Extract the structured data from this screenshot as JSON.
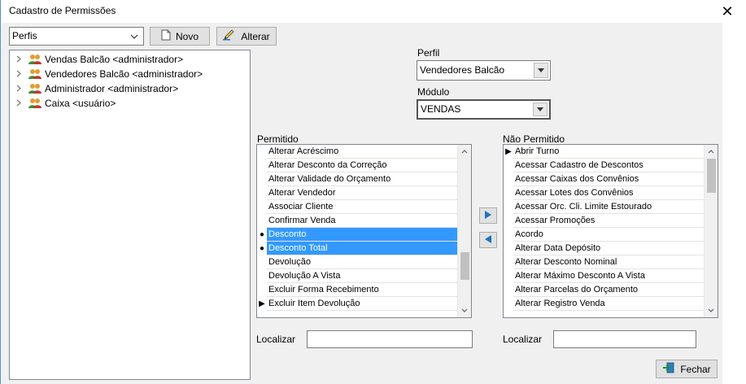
{
  "window": {
    "title": "Cadastro de Permissões"
  },
  "toolbar": {
    "perfis_combo_value": "Perfis",
    "novo_label": "Novo",
    "alterar_label": "Alterar"
  },
  "tree": {
    "items": [
      {
        "label": "Vendas Balcão <administrador>"
      },
      {
        "label": "Vendedores Balcão <administrador>"
      },
      {
        "label": "Administrador <administrador>"
      },
      {
        "label": "Caixa <usuário>"
      }
    ]
  },
  "form": {
    "perfil_label": "Perfil",
    "perfil_value": "Vendedores Balcão",
    "modulo_label": "Módulo",
    "modulo_value": "VENDAS"
  },
  "permitido": {
    "label": "Permitido",
    "rows": [
      {
        "text": "Alterar Acréscimo"
      },
      {
        "text": "Alterar Desconto da Correção"
      },
      {
        "text": "Alterar Validade do Orçamento"
      },
      {
        "text": "Alterar Vendedor"
      },
      {
        "text": "Associar Cliente"
      },
      {
        "text": "Confirmar Venda"
      },
      {
        "text": "Desconto"
      },
      {
        "text": "Desconto Total"
      },
      {
        "text": "Devolução"
      },
      {
        "text": "Devolução A Vista"
      },
      {
        "text": "Excluir Forma Recebimento"
      },
      {
        "text": "Excluir Item Devolução"
      }
    ],
    "localizar_label": "Localizar",
    "localizar_value": ""
  },
  "nao_permitido": {
    "label": "Não Permitido",
    "rows": [
      {
        "text": "Abrir Turno"
      },
      {
        "text": "Acessar Cadastro de Descontos"
      },
      {
        "text": "Acessar Caixas dos Convênios"
      },
      {
        "text": "Acessar Lotes dos Convênios"
      },
      {
        "text": "Acessar Orc. Cli. Limite Estourado"
      },
      {
        "text": "Acessar Promoções"
      },
      {
        "text": "Acordo"
      },
      {
        "text": "Alterar Data Depósito"
      },
      {
        "text": "Alterar Desconto Nominal"
      },
      {
        "text": "Alterar Máximo Desconto A Vista"
      },
      {
        "text": "Alterar Parcelas do Orçamento"
      },
      {
        "text": "Alterar Registro Venda"
      }
    ],
    "localizar_label": "Localizar",
    "localizar_value": ""
  },
  "footer": {
    "fechar_label": "Fechar"
  },
  "colors": {
    "selection": "#3399ff",
    "accent_blue": "#1e73be"
  }
}
